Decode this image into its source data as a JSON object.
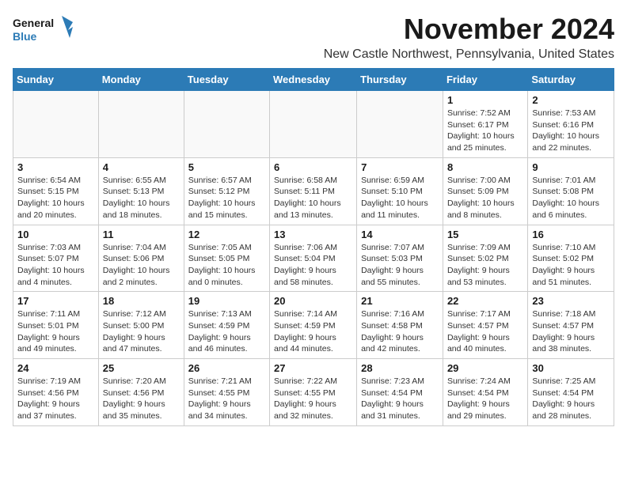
{
  "header": {
    "logo_line1": "General",
    "logo_line2": "Blue",
    "month": "November 2024",
    "location": "New Castle Northwest, Pennsylvania, United States"
  },
  "weekdays": [
    "Sunday",
    "Monday",
    "Tuesday",
    "Wednesday",
    "Thursday",
    "Friday",
    "Saturday"
  ],
  "weeks": [
    [
      {
        "day": "",
        "info": ""
      },
      {
        "day": "",
        "info": ""
      },
      {
        "day": "",
        "info": ""
      },
      {
        "day": "",
        "info": ""
      },
      {
        "day": "",
        "info": ""
      },
      {
        "day": "1",
        "info": "Sunrise: 7:52 AM\nSunset: 6:17 PM\nDaylight: 10 hours and 25 minutes."
      },
      {
        "day": "2",
        "info": "Sunrise: 7:53 AM\nSunset: 6:16 PM\nDaylight: 10 hours and 22 minutes."
      }
    ],
    [
      {
        "day": "3",
        "info": "Sunrise: 6:54 AM\nSunset: 5:15 PM\nDaylight: 10 hours and 20 minutes."
      },
      {
        "day": "4",
        "info": "Sunrise: 6:55 AM\nSunset: 5:13 PM\nDaylight: 10 hours and 18 minutes."
      },
      {
        "day": "5",
        "info": "Sunrise: 6:57 AM\nSunset: 5:12 PM\nDaylight: 10 hours and 15 minutes."
      },
      {
        "day": "6",
        "info": "Sunrise: 6:58 AM\nSunset: 5:11 PM\nDaylight: 10 hours and 13 minutes."
      },
      {
        "day": "7",
        "info": "Sunrise: 6:59 AM\nSunset: 5:10 PM\nDaylight: 10 hours and 11 minutes."
      },
      {
        "day": "8",
        "info": "Sunrise: 7:00 AM\nSunset: 5:09 PM\nDaylight: 10 hours and 8 minutes."
      },
      {
        "day": "9",
        "info": "Sunrise: 7:01 AM\nSunset: 5:08 PM\nDaylight: 10 hours and 6 minutes."
      }
    ],
    [
      {
        "day": "10",
        "info": "Sunrise: 7:03 AM\nSunset: 5:07 PM\nDaylight: 10 hours and 4 minutes."
      },
      {
        "day": "11",
        "info": "Sunrise: 7:04 AM\nSunset: 5:06 PM\nDaylight: 10 hours and 2 minutes."
      },
      {
        "day": "12",
        "info": "Sunrise: 7:05 AM\nSunset: 5:05 PM\nDaylight: 10 hours and 0 minutes."
      },
      {
        "day": "13",
        "info": "Sunrise: 7:06 AM\nSunset: 5:04 PM\nDaylight: 9 hours and 58 minutes."
      },
      {
        "day": "14",
        "info": "Sunrise: 7:07 AM\nSunset: 5:03 PM\nDaylight: 9 hours and 55 minutes."
      },
      {
        "day": "15",
        "info": "Sunrise: 7:09 AM\nSunset: 5:02 PM\nDaylight: 9 hours and 53 minutes."
      },
      {
        "day": "16",
        "info": "Sunrise: 7:10 AM\nSunset: 5:02 PM\nDaylight: 9 hours and 51 minutes."
      }
    ],
    [
      {
        "day": "17",
        "info": "Sunrise: 7:11 AM\nSunset: 5:01 PM\nDaylight: 9 hours and 49 minutes."
      },
      {
        "day": "18",
        "info": "Sunrise: 7:12 AM\nSunset: 5:00 PM\nDaylight: 9 hours and 47 minutes."
      },
      {
        "day": "19",
        "info": "Sunrise: 7:13 AM\nSunset: 4:59 PM\nDaylight: 9 hours and 46 minutes."
      },
      {
        "day": "20",
        "info": "Sunrise: 7:14 AM\nSunset: 4:59 PM\nDaylight: 9 hours and 44 minutes."
      },
      {
        "day": "21",
        "info": "Sunrise: 7:16 AM\nSunset: 4:58 PM\nDaylight: 9 hours and 42 minutes."
      },
      {
        "day": "22",
        "info": "Sunrise: 7:17 AM\nSunset: 4:57 PM\nDaylight: 9 hours and 40 minutes."
      },
      {
        "day": "23",
        "info": "Sunrise: 7:18 AM\nSunset: 4:57 PM\nDaylight: 9 hours and 38 minutes."
      }
    ],
    [
      {
        "day": "24",
        "info": "Sunrise: 7:19 AM\nSunset: 4:56 PM\nDaylight: 9 hours and 37 minutes."
      },
      {
        "day": "25",
        "info": "Sunrise: 7:20 AM\nSunset: 4:56 PM\nDaylight: 9 hours and 35 minutes."
      },
      {
        "day": "26",
        "info": "Sunrise: 7:21 AM\nSunset: 4:55 PM\nDaylight: 9 hours and 34 minutes."
      },
      {
        "day": "27",
        "info": "Sunrise: 7:22 AM\nSunset: 4:55 PM\nDaylight: 9 hours and 32 minutes."
      },
      {
        "day": "28",
        "info": "Sunrise: 7:23 AM\nSunset: 4:54 PM\nDaylight: 9 hours and 31 minutes."
      },
      {
        "day": "29",
        "info": "Sunrise: 7:24 AM\nSunset: 4:54 PM\nDaylight: 9 hours and 29 minutes."
      },
      {
        "day": "30",
        "info": "Sunrise: 7:25 AM\nSunset: 4:54 PM\nDaylight: 9 hours and 28 minutes."
      }
    ]
  ]
}
